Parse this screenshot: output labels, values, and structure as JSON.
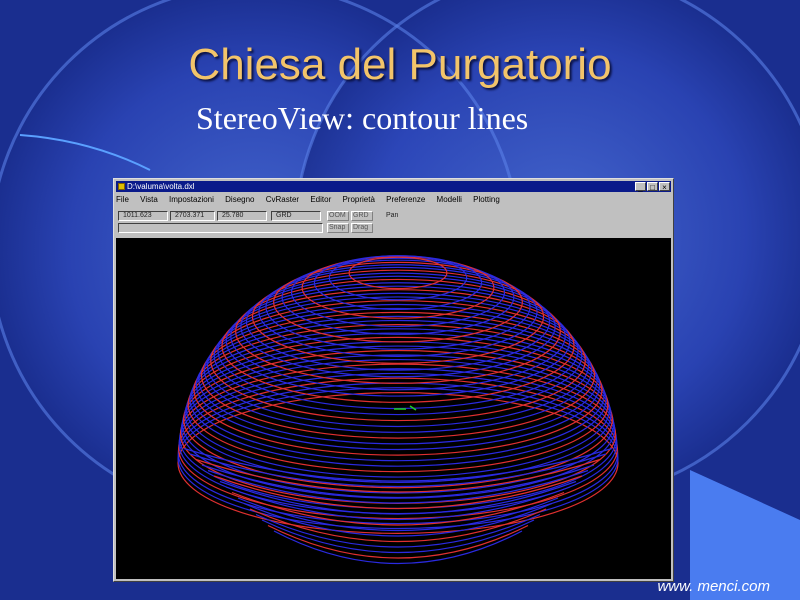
{
  "slide": {
    "title": "Chiesa del Purgatorio",
    "subtitle": "StereoView: contour lines",
    "footer": "www. menci.com",
    "colors": {
      "background": "#1a2e8f",
      "title": "#f2c46a",
      "text": "#ffffff",
      "accent_corner": "#4a7cf0"
    }
  },
  "window": {
    "title": "D:\\valuma\\volta.dxl",
    "buttons": [
      "_",
      "□",
      "×"
    ],
    "menu": [
      "File",
      "Vista",
      "Impostazioni",
      "Disegno",
      "CvRaster",
      "Editor",
      "Proprietà",
      "Preferenze",
      "Modelli",
      "Plotting"
    ],
    "status": {
      "x": "1011.623",
      "y": "2703.371",
      "z": "25.780",
      "mode": "GRD",
      "buttons": [
        "OOM",
        "GRD",
        "Snap",
        "Drag"
      ],
      "pan_label": "Pan"
    }
  },
  "viewer": {
    "background": "#000000",
    "contour_colors": {
      "primary": "#2a2ae0",
      "secondary": "#e03030",
      "marker": "#20d020"
    }
  }
}
